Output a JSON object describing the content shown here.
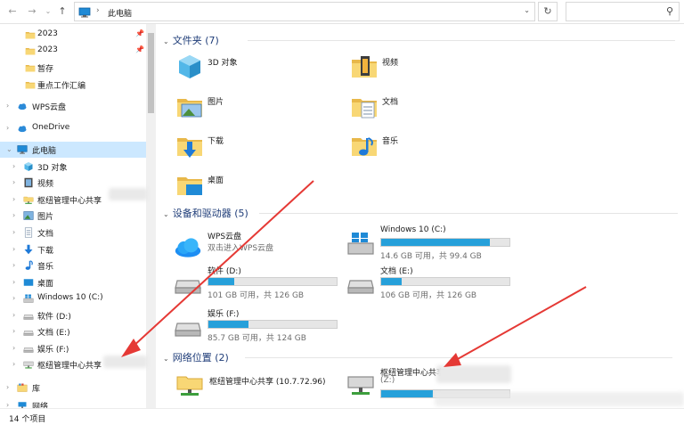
{
  "address": {
    "path": "此电脑"
  },
  "sidebar": {
    "items": [
      {
        "label": "2023",
        "icon": "folder-icon",
        "pinned": true
      },
      {
        "label": "2023",
        "icon": "folder-icon",
        "pinned": true
      },
      {
        "label": "暂存",
        "icon": "folder-icon"
      },
      {
        "label": "重点工作汇编",
        "icon": "folder-icon"
      },
      {
        "label": "WPS云盘",
        "icon": "cloud-icon"
      },
      {
        "label": "OneDrive",
        "icon": "cloud-icon"
      },
      {
        "label": "此电脑",
        "icon": "pc-icon",
        "selected": true
      },
      {
        "label": "3D 对象",
        "icon": "3d-objects-icon"
      },
      {
        "label": "视频",
        "icon": "video-icon"
      },
      {
        "label": "枢纽管理中心共享",
        "icon": "network-folder-icon"
      },
      {
        "label": "图片",
        "icon": "pictures-icon"
      },
      {
        "label": "文档",
        "icon": "documents-icon"
      },
      {
        "label": "下载",
        "icon": "download-icon"
      },
      {
        "label": "音乐",
        "icon": "music-icon"
      },
      {
        "label": "桌面",
        "icon": "desktop-icon"
      },
      {
        "label": "Windows 10 (C:)",
        "icon": "windows-drive-icon"
      },
      {
        "label": "软件 (D:)",
        "icon": "drive-icon"
      },
      {
        "label": "文档 (E:)",
        "icon": "drive-icon"
      },
      {
        "label": "娱乐 (F:)",
        "icon": "drive-icon"
      },
      {
        "label": "枢纽管理中心共享",
        "icon": "network-drive-icon"
      },
      {
        "label": "库",
        "icon": "library-icon"
      },
      {
        "label": "网络",
        "icon": "network-icon"
      }
    ]
  },
  "sections": {
    "folders": "文件夹 (7)",
    "drives": "设备和驱动器 (5)",
    "network": "网络位置 (2)"
  },
  "folders": [
    {
      "name": "3D 对象",
      "icon": "3d-objects-icon"
    },
    {
      "name": "视频",
      "icon": "video-folder-icon"
    },
    {
      "name": "图片",
      "icon": "pictures-folder-icon"
    },
    {
      "name": "文档",
      "icon": "documents-folder-icon"
    },
    {
      "name": "下载",
      "icon": "download-folder-icon"
    },
    {
      "name": "音乐",
      "icon": "music-folder-icon"
    },
    {
      "name": "桌面",
      "icon": "desktop-folder-icon"
    }
  ],
  "drives": [
    {
      "name": "WPS云盘",
      "sub": "双击进入WPS云盘",
      "icon": "wps-cloud-icon"
    },
    {
      "name": "Windows 10 (C:)",
      "free": "14.6 GB 可用，共 99.4 GB",
      "used_fraction": 0.85,
      "icon": "windows-drive-icon"
    },
    {
      "name": "软件 (D:)",
      "free": "101 GB 可用，共 126 GB",
      "used_fraction": 0.2,
      "icon": "drive-icon"
    },
    {
      "name": "文档 (E:)",
      "free": "106 GB 可用，共 126 GB",
      "used_fraction": 0.16,
      "icon": "drive-icon"
    },
    {
      "name": "娱乐 (F:)",
      "free": "85.7 GB 可用，共 124 GB",
      "used_fraction": 0.31,
      "icon": "drive-icon"
    }
  ],
  "network": [
    {
      "name": "枢纽管理中心共享 (10.7.72.96)",
      "icon": "network-folder-icon"
    },
    {
      "name": "枢纽管理中心共享",
      "sub": "(Z:)",
      "used_fraction": 0.4,
      "icon": "network-drive-icon"
    }
  ],
  "status": {
    "count": "14 个项目"
  },
  "colors": {
    "accent": "#26a0da",
    "selected": "#cce8ff",
    "section": "#1e3c78",
    "arrow": "#e53935"
  }
}
